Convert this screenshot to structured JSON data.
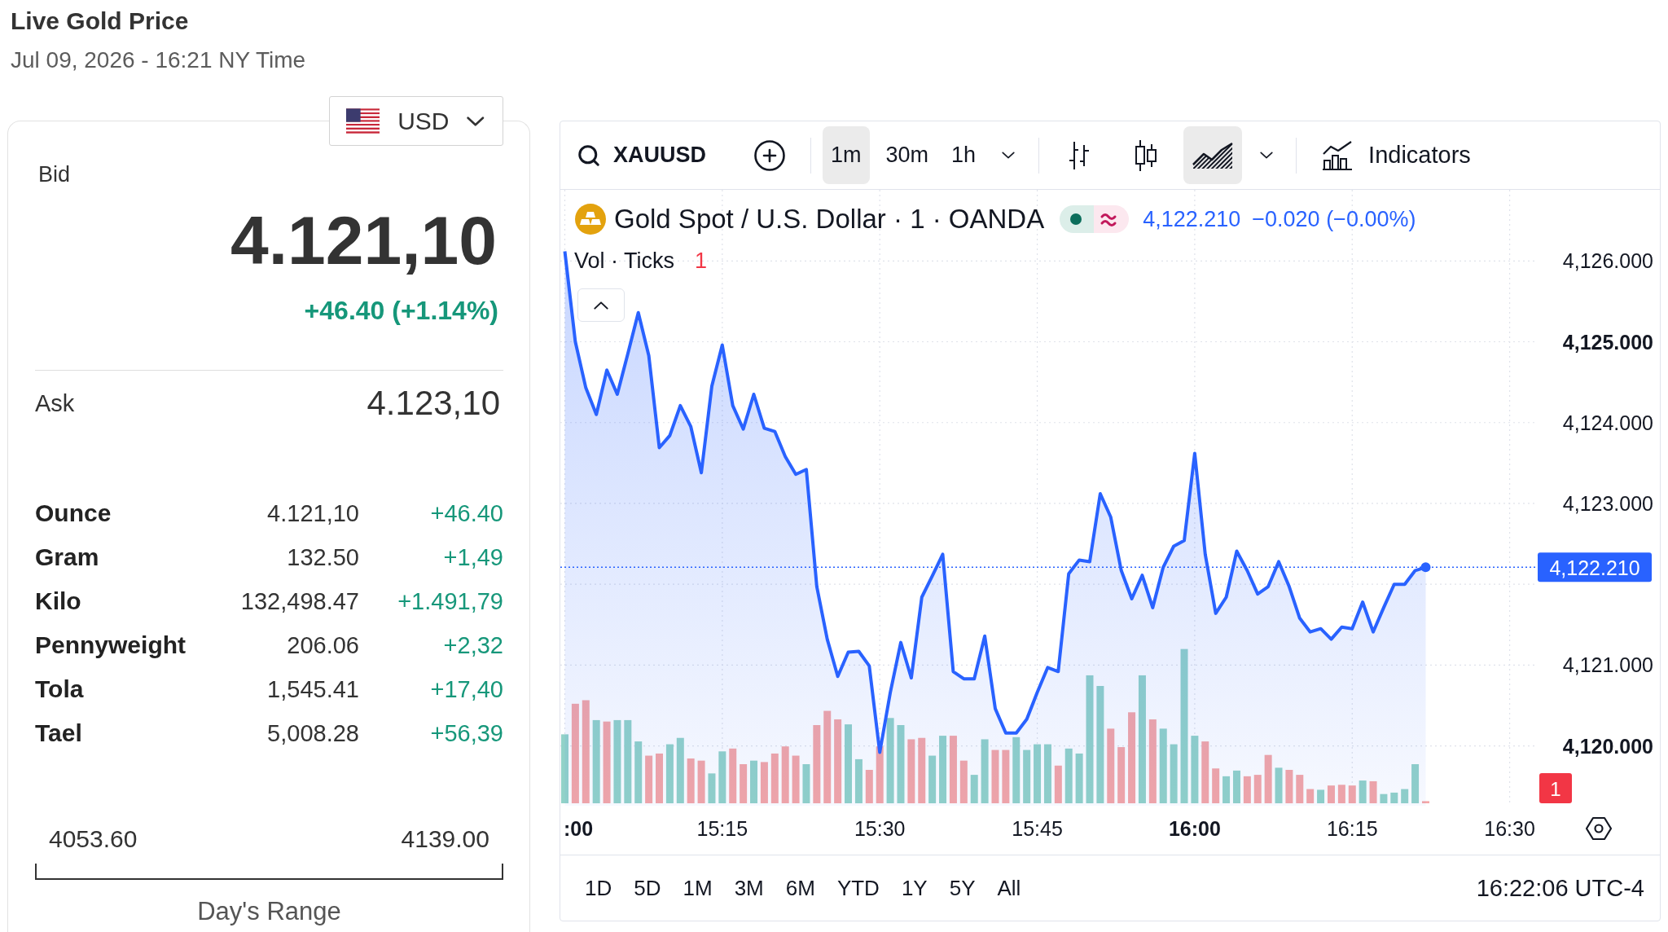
{
  "header": {
    "title": "Live Gold Price",
    "timestamp": "Jul 09, 2026 - 16:21 NY Time"
  },
  "currency": {
    "code": "USD"
  },
  "quote": {
    "bid_label": "Bid",
    "bid": "4.121,10",
    "change": "+46.40 (+1.14%)",
    "ask_label": "Ask",
    "ask": "4.123,10"
  },
  "units": [
    {
      "name": "Ounce",
      "price": "4.121,10",
      "change": "+46.40"
    },
    {
      "name": "Gram",
      "price": "132.50",
      "change": "+1,49"
    },
    {
      "name": "Kilo",
      "price": "132,498.47",
      "change": "+1.491,79"
    },
    {
      "name": "Pennyweight",
      "price": "206.06",
      "change": "+2,32"
    },
    {
      "name": "Tola",
      "price": "1,545.41",
      "change": "+17,40"
    },
    {
      "name": "Tael",
      "price": "5,008.28",
      "change": "+56,39"
    }
  ],
  "day_range": {
    "low": "4053.60",
    "high": "4139.00",
    "label": "Day's Range"
  },
  "chart_panel": {
    "toolbar": {
      "symbol": "XAUUSD",
      "intervals": [
        {
          "label": "1m",
          "selected": true
        },
        {
          "label": "30m",
          "selected": false
        },
        {
          "label": "1h",
          "selected": false
        }
      ],
      "chart_types": [
        {
          "kind": "bars",
          "selected": false
        },
        {
          "kind": "candles",
          "selected": false
        },
        {
          "kind": "area",
          "selected": true
        }
      ],
      "indicators_label": "Indicators"
    },
    "legend": {
      "last": "4,122.210",
      "change": "−0.020 (−0.00%)",
      "volume_title": "Vol · Ticks",
      "volume_value": "1"
    },
    "chart": {
      "chart_data": {
        "type": "area",
        "grid": true,
        "categories": [
          null,
          null,
          null,
          null,
          null,
          null,
          null,
          null,
          null,
          null,
          null,
          null,
          null,
          null,
          null,
          "15:15",
          null,
          null,
          null,
          null,
          null,
          null,
          null,
          null,
          null,
          null,
          null,
          null,
          null,
          null,
          "15:30",
          null,
          null,
          null,
          null,
          null,
          null,
          null,
          null,
          null,
          null,
          null,
          null,
          null,
          null,
          "15:45",
          null,
          null,
          null,
          null,
          null,
          null,
          null,
          null,
          null,
          null,
          null,
          null,
          null,
          null,
          "16:00",
          null,
          null,
          null,
          null,
          null,
          null,
          null,
          null,
          null,
          null,
          null,
          null,
          null,
          null,
          "16:15",
          null,
          null,
          null,
          null,
          null,
          null,
          null,
          null,
          null,
          null,
          null,
          null,
          null,
          null,
          "16:30"
        ],
        "series": [
          {
            "name": "Gold Spot / U.S. Dollar · 1 · OANDA",
            "color": "#2962ff",
            "values": [
              4126.12,
              4125.0,
              4124.43,
              4124.1,
              4124.65,
              4124.35,
              4124.85,
              4125.36,
              4124.83,
              4123.69,
              4123.84,
              4124.21,
              4123.95,
              4123.38,
              4124.45,
              4124.96,
              4124.21,
              4123.92,
              4124.35,
              4123.93,
              4123.89,
              4123.58,
              4123.36,
              4123.42,
              4121.97,
              4121.32,
              4120.86,
              4121.16,
              4121.17,
              4120.99,
              4119.92,
              4120.66,
              4121.28,
              4120.84,
              4121.84,
              4122.1,
              4122.37,
              4120.92,
              4120.83,
              4120.83,
              4121.36,
              4120.46,
              4120.16,
              4120.16,
              4120.33,
              4120.66,
              4120.97,
              4120.92,
              4122.13,
              4122.3,
              4122.28,
              4123.12,
              4122.83,
              4122.17,
              4121.82,
              4122.11,
              4121.71,
              4122.21,
              4122.47,
              4122.54,
              4123.62,
              4122.37,
              4121.64,
              4121.84,
              4122.41,
              4122.17,
              4121.88,
              4121.97,
              4122.28,
              4121.97,
              4121.58,
              4121.41,
              4121.45,
              4121.32,
              4121.47,
              4121.45,
              4121.78,
              4121.41,
              4121.71,
              4122.0,
              4122.0,
              4122.17,
              4122.21,
              null,
              null,
              null,
              null,
              null,
              null,
              null,
              null
            ]
          }
        ],
        "ylim": [
          4119.26,
          4126.88
        ],
        "yticks": [
          {
            "value": 4126,
            "label": "4,126.000"
          },
          {
            "value": 4125,
            "label": "4,125.000"
          },
          {
            "value": 4124,
            "label": "4,124.000"
          },
          {
            "value": 4123,
            "label": "4,123.000"
          },
          {
            "value": 4121,
            "label": "4,121.000"
          },
          {
            "value": 4120,
            "label": "4,120.000"
          }
        ],
        "ref_lines": [
          {
            "axis": "y",
            "value": 4122.21,
            "label": "4,122.210",
            "color": "#2962ff"
          }
        ]
      },
      "edge_time_label": ":00",
      "volume_label": "1"
    },
    "ranges": [
      {
        "label": "1D",
        "selected": false
      },
      {
        "label": "5D",
        "selected": false
      },
      {
        "label": "1M",
        "selected": false
      },
      {
        "label": "3M",
        "selected": false
      },
      {
        "label": "6M",
        "selected": false
      },
      {
        "label": "YTD",
        "selected": false
      },
      {
        "label": "1Y",
        "selected": false
      },
      {
        "label": "5Y",
        "selected": false
      },
      {
        "label": "All",
        "selected": false
      }
    ],
    "clock": "16:22:06 UTC-4"
  }
}
